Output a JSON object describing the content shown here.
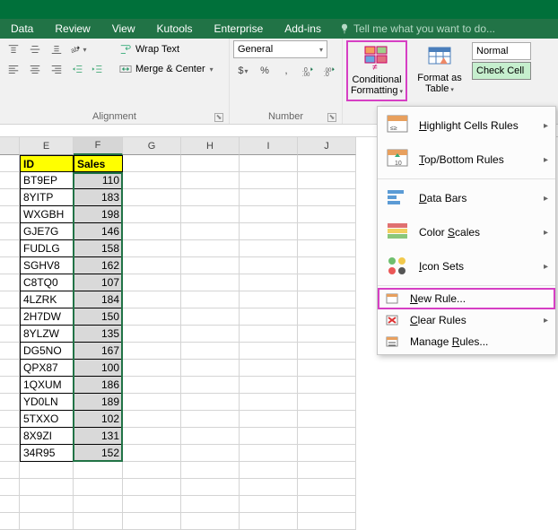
{
  "titlebar": {
    "text": ""
  },
  "tabs": [
    "Data",
    "Review",
    "View",
    "Kutools",
    "Enterprise",
    "Add-ins"
  ],
  "tell_me": "Tell me what you want to do...",
  "ribbon": {
    "alignment": {
      "wrap_text": "Wrap Text",
      "merge_center": "Merge & Center",
      "label": "Alignment"
    },
    "number": {
      "format": "General",
      "label": "Number"
    },
    "styles": {
      "conditional": {
        "line1": "Conditional",
        "line2": "Formatting"
      },
      "format_as_table": {
        "line1": "Format as",
        "line2": "Table"
      },
      "normal": "Normal",
      "check_cell": "Check Cell"
    }
  },
  "menu": {
    "highlight": "Highlight Cells Rules",
    "topbottom": "Top/Bottom Rules",
    "databars": "Data Bars",
    "colorscales": "Color Scales",
    "iconsets": "Icon Sets",
    "newrule": "New Rule...",
    "clearrules": "Clear Rules",
    "managerules": "Manage Rules..."
  },
  "columns": [
    "E",
    "F",
    "G",
    "H",
    "I",
    "J"
  ],
  "headers": {
    "E": "ID",
    "F": "Sales"
  },
  "data": [
    {
      "id": "BT9EP",
      "sales": 110
    },
    {
      "id": "8YITP",
      "sales": 183
    },
    {
      "id": "WXGBH",
      "sales": 198
    },
    {
      "id": "GJE7G",
      "sales": 146
    },
    {
      "id": "FUDLG",
      "sales": 158
    },
    {
      "id": "SGHV8",
      "sales": 162
    },
    {
      "id": "C8TQ0",
      "sales": 107
    },
    {
      "id": "4LZRK",
      "sales": 184
    },
    {
      "id": "2H7DW",
      "sales": 150
    },
    {
      "id": "8YLZW",
      "sales": 135
    },
    {
      "id": "DG5NO",
      "sales": 167
    },
    {
      "id": "QPX87",
      "sales": 100
    },
    {
      "id": "1QXUM",
      "sales": 186
    },
    {
      "id": "YD0LN",
      "sales": 189
    },
    {
      "id": "5TXXO",
      "sales": 102
    },
    {
      "id": "8X9ZI",
      "sales": 131
    },
    {
      "id": "34R95",
      "sales": 152
    }
  ]
}
